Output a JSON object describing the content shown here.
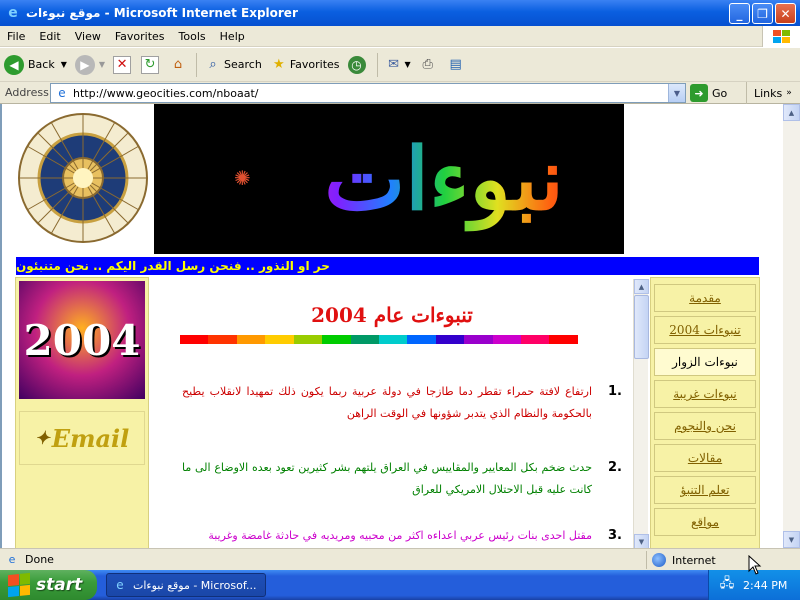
{
  "window": {
    "title": "موقع نبوءات - Microsoft Internet Explorer"
  },
  "menu": [
    "File",
    "Edit",
    "View",
    "Favorites",
    "Tools",
    "Help"
  ],
  "toolbar": {
    "back_label": "Back",
    "search_label": "Search",
    "favorites_label": "Favorites"
  },
  "address": {
    "label": "Address",
    "url": "http://www.geocities.com/nboaat/",
    "go_label": "Go",
    "links_label": "Links"
  },
  "page": {
    "banner_title": "نبوءات",
    "tagline": "حر او النذور .. فنحن رسل القدر اليكم .. نحن متنبئون",
    "year_image_text": "2004",
    "email_image_text": "Email",
    "heading": "تنبوءات عام 2004",
    "rainbow_colors": [
      "#ff0000",
      "#ff3300",
      "#ff9900",
      "#ffcc00",
      "#99cc00",
      "#00cc00",
      "#009966",
      "#00cccc",
      "#0066ff",
      "#3300cc",
      "#9900cc",
      "#cc00cc",
      "#ff0066",
      "#ff0000"
    ],
    "items": [
      {
        "num": "1.",
        "text": "ارتفاع لافتة حمراء تقطر دما طازجا في دولة عربية ربما يكون ذلك تمهيدا لانقلاب يطيح بالحكومة والنظام الذي يتدبر شؤونها في الوقت الراهن",
        "color": "#cc0000"
      },
      {
        "num": "2.",
        "text": "حدث ضخم بكل المعايير والمقاييس في العراق يلتهم بشر كثيرين تعود بعده الاوضاع الى ما كانت عليه قبل الاحتلال الامريكي للعراق",
        "color": "#008000"
      },
      {
        "num": "3.",
        "text": "مقتل احدى بنات رئيس عربي اعداءه اكثر من محبيه ومريديه في حادثة غامضة وغريبة",
        "color": "#cc00cc"
      }
    ],
    "nav": [
      {
        "label": "مقدمة",
        "active": false
      },
      {
        "label": "تنبوءات 2004",
        "active": false
      },
      {
        "label": "نبوءات الزوار",
        "active": true
      },
      {
        "label": "نبوءات غريبة",
        "active": false
      },
      {
        "label": "نحن والنجوم",
        "active": false
      },
      {
        "label": "مقالات",
        "active": false
      },
      {
        "label": "تعلم التنبؤ",
        "active": false
      },
      {
        "label": "مواقع",
        "active": false
      }
    ]
  },
  "status": {
    "text": "Done",
    "zone": "Internet"
  },
  "taskbar": {
    "start_label": "start",
    "task_label": "موقع نبوءات - Microsof...",
    "clock": "2:44 PM"
  }
}
